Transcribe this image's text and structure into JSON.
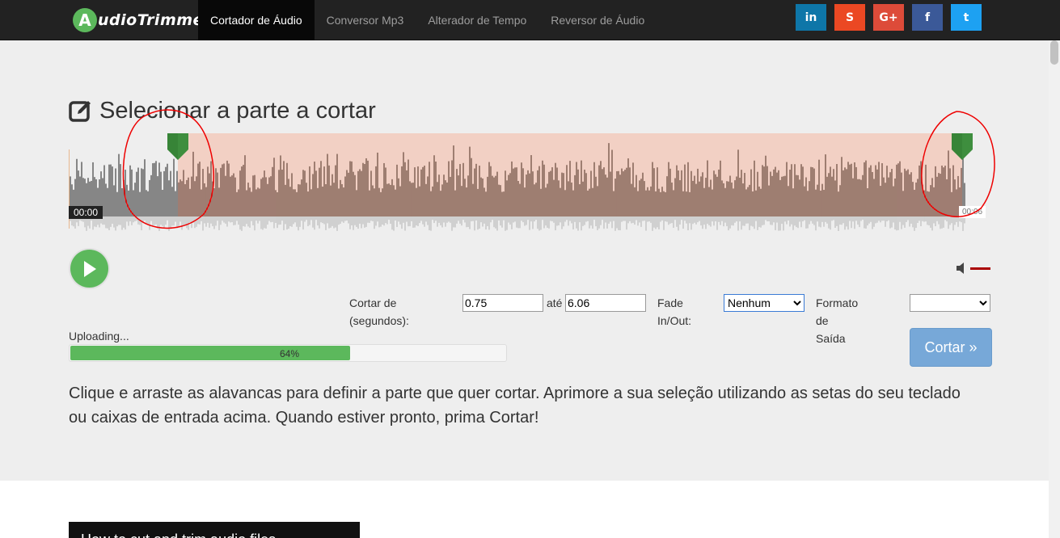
{
  "brand": {
    "logo_letter": "A",
    "logo_text": "udioTrimmer"
  },
  "nav": {
    "items": [
      {
        "label": "Cortador de Áudio",
        "active": true
      },
      {
        "label": "Conversor Mp3"
      },
      {
        "label": "Alterador de Tempo"
      },
      {
        "label": "Reversor de Áudio"
      }
    ]
  },
  "social": [
    {
      "label": "in",
      "name": "linkedin",
      "color": "#0e76a8"
    },
    {
      "label": "S",
      "name": "stumbleupon",
      "color": "#eb4823"
    },
    {
      "label": "G+",
      "name": "google-plus",
      "color": "#dd4b39"
    },
    {
      "label": "f",
      "name": "facebook",
      "color": "#3b5998"
    },
    {
      "label": "t",
      "name": "twitter",
      "color": "#1da1f2"
    }
  ],
  "title": "Selecionar a parte a cortar",
  "player": {
    "time_start": "00:00",
    "time_end": "00:06"
  },
  "controls": {
    "cut_from_label": "Cortar de (segundos):",
    "cut_from_value": "0.75",
    "to_label": "até",
    "to_value": "6.06",
    "fade_label": "Fade In/Out:",
    "fade_value": "Nenhum",
    "format_label": "Formato de Saída",
    "format_value": ""
  },
  "upload": {
    "status": "Uploading...",
    "progress": 64,
    "progress_text": "64%"
  },
  "cut_button": "Cortar »",
  "instructions": "Clique e arraste as alavancas para definir a parte que quer cortar. Aprimore a sua seleção utilizando as setas do seu teclado ou caixas de entrada acima. Quando estiver pronto, prima Cortar!",
  "video": {
    "title": "How to cut and trim audio files"
  },
  "colors": {
    "accent_green": "#5cb85c",
    "selection": "#f2d0c4",
    "wave_selected": "#7b5a4e",
    "wave_unselected": "#5a5a5a",
    "cut_button": "#77a8d8"
  }
}
